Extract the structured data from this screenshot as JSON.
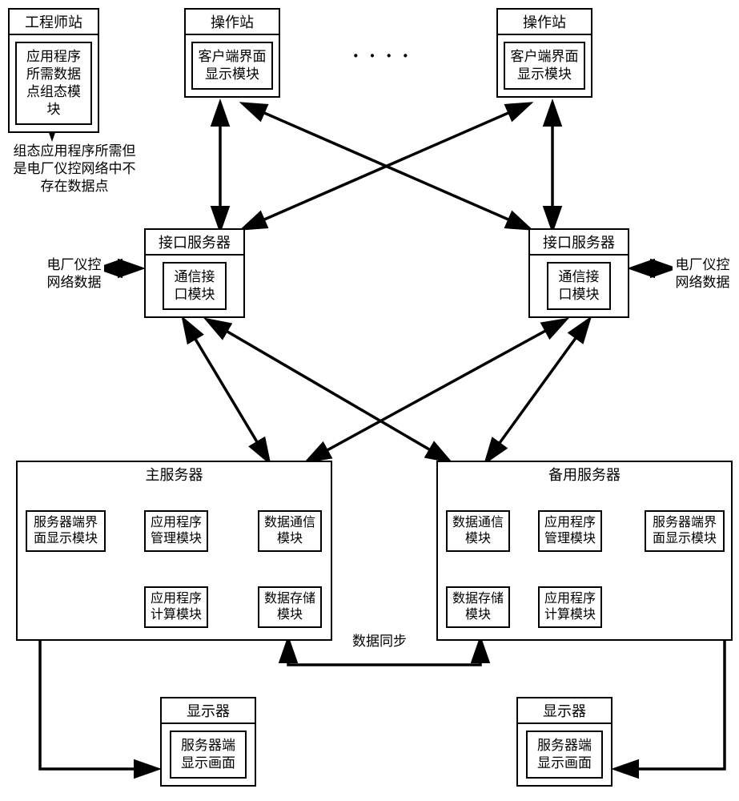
{
  "engineer_station": {
    "title": "工程师站",
    "module": "应用程序所需数据点组态模块"
  },
  "engineer_annotation": "组态应用程序所需但是电厂仪控网络中不存在数据点",
  "op_station": {
    "title": "操作站",
    "module": "客户端界面显示模块"
  },
  "interface_server": {
    "title": "接口服务器",
    "module": "通信接口模块"
  },
  "interface_annotation_left": "电厂仪控网络数据",
  "interface_annotation_right": "电厂仪控网络数据",
  "main_server": {
    "title": "主服务器",
    "srv_ui": "服务器端界面显示模块",
    "app_mgmt": "应用程序管理模块",
    "data_comm": "数据通信模块",
    "app_calc": "应用程序计算模块",
    "data_store": "数据存储模块"
  },
  "backup_server": {
    "title": "备用服务器",
    "srv_ui": "服务器端界面显示模块",
    "app_mgmt": "应用程序管理模块",
    "data_comm": "数据通信模块",
    "app_calc": "应用程序计算模块",
    "data_store": "数据存储模块"
  },
  "data_sync": "数据同步",
  "display": {
    "title": "显示器",
    "content": "服务器端显示画面"
  },
  "dots": "····"
}
